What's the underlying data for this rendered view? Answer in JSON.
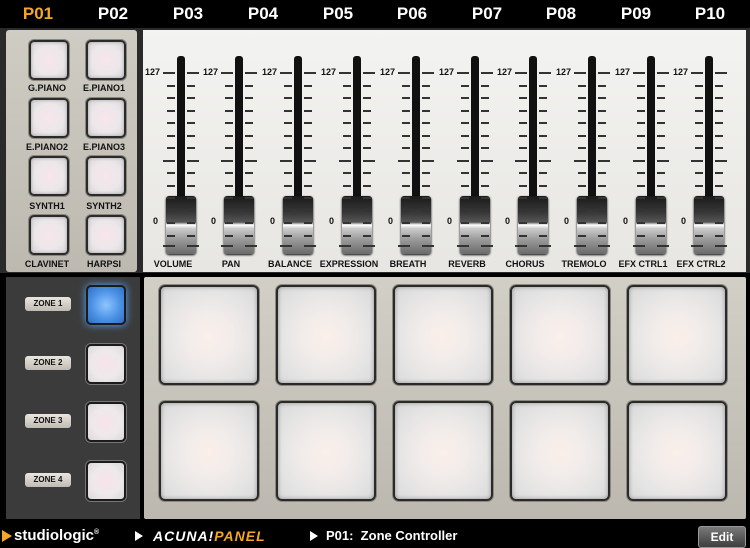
{
  "tabs": {
    "items": [
      "P01",
      "P02",
      "P03",
      "P04",
      "P05",
      "P06",
      "P07",
      "P08",
      "P09",
      "P10"
    ],
    "active_index": 0,
    "active_color": "#f5a623"
  },
  "programs": {
    "labels": [
      "G.PIANO",
      "E.PIANO1",
      "E.PIANO2",
      "E.PIANO3",
      "SYNTH1",
      "SYNTH2",
      "CLAVINET",
      "HARPSI"
    ]
  },
  "faders": {
    "items": [
      {
        "label": "VOLUME",
        "max": "127",
        "min": "0"
      },
      {
        "label": "PAN",
        "max": "127",
        "min": "0"
      },
      {
        "label": "BALANCE",
        "max": "127",
        "min": "0"
      },
      {
        "label": "EXPRESSION",
        "max": "127",
        "min": "0"
      },
      {
        "label": "BREATH",
        "max": "127",
        "min": "0"
      },
      {
        "label": "REVERB",
        "max": "127",
        "min": "0"
      },
      {
        "label": "CHORUS",
        "max": "127",
        "min": "0"
      },
      {
        "label": "TREMOLO",
        "max": "127",
        "min": "0"
      },
      {
        "label": "EFX CTRL1",
        "max": "127",
        "min": "0"
      },
      {
        "label": "EFX CTRL2",
        "max": "127",
        "min": "0"
      }
    ],
    "level": 0
  },
  "zones": {
    "labels": [
      "ZONE 1",
      "ZONE 2",
      "ZONE 3",
      "ZONE 4"
    ],
    "active_index": 0,
    "active_color": "#4d93e6"
  },
  "pads": {
    "count": 10
  },
  "footer": {
    "brand": "studiologic",
    "brand_mark": "®",
    "product_part1": "ACUNA!",
    "product_part2": "PANEL",
    "breadcrumb": "P01:  Zone Controller",
    "edit_label": "Edit"
  }
}
